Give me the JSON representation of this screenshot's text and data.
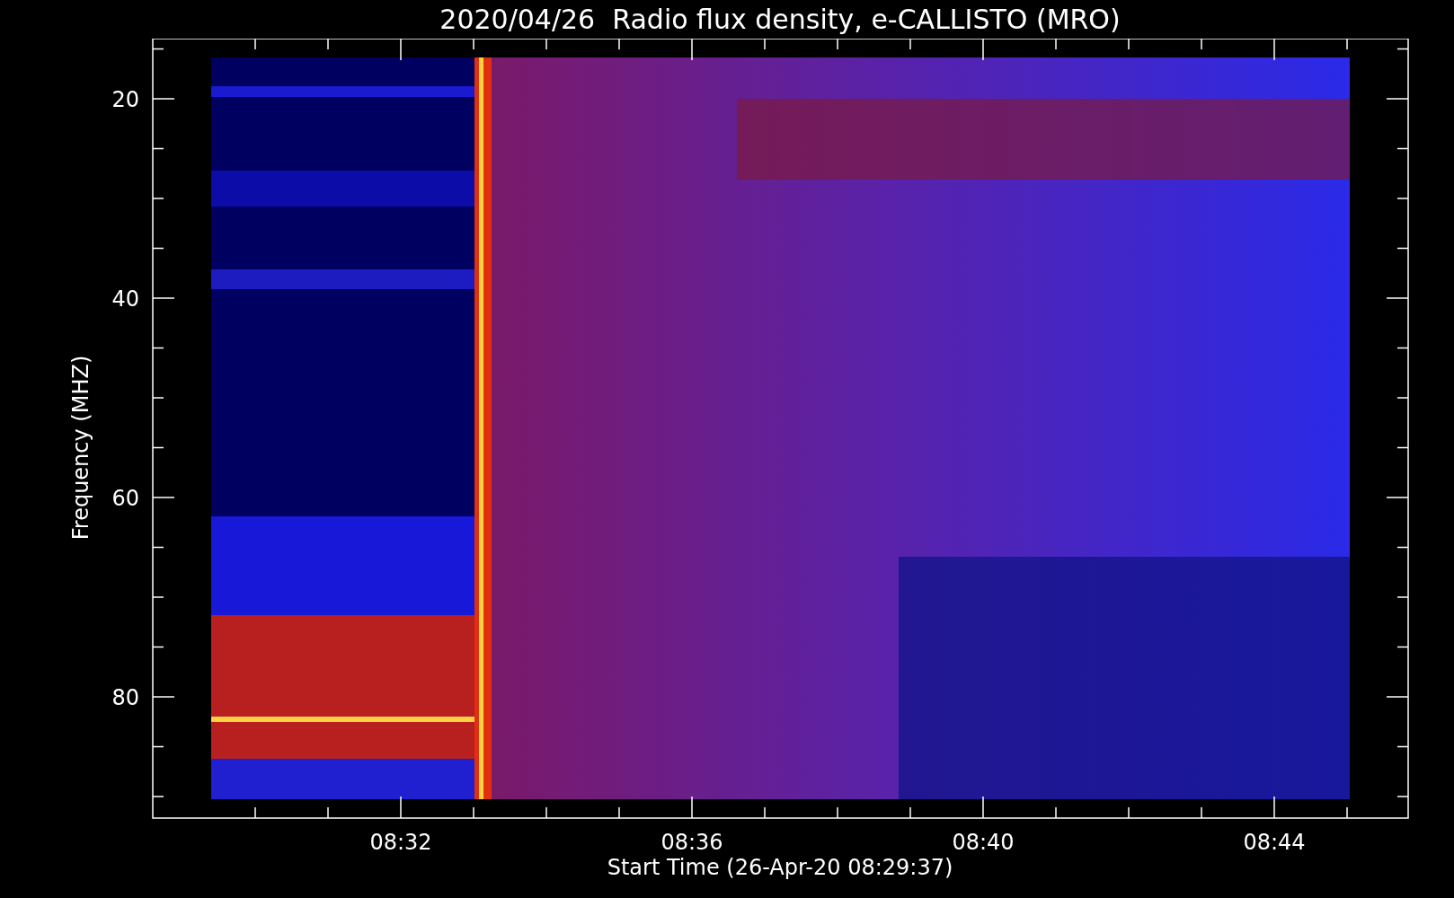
{
  "title": "2020/04/26  Radio flux density, e-CALLISTO (MRO)",
  "plot": {
    "ylabel": "Frequency (MHZ)",
    "xlabel": "Start Time (26-Apr-20 08:29:37)",
    "yticks": [
      "20",
      "40",
      "60",
      "80"
    ],
    "xticks": [
      "08:32",
      "08:36",
      "08:40",
      "08:44"
    ]
  }
}
